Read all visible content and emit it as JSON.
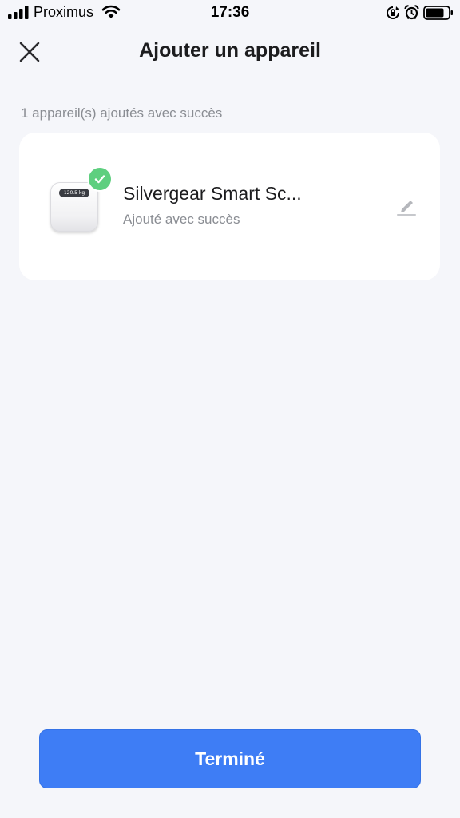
{
  "status_bar": {
    "carrier": "Proximus",
    "time": "17:36",
    "icons": [
      "signal-icon",
      "wifi-icon",
      "lock-rotation-icon",
      "alarm-icon",
      "battery-icon"
    ]
  },
  "header": {
    "title": "Ajouter un appareil",
    "close_icon": "close-icon"
  },
  "summary": "1 appareil(s) ajoutés avec succès",
  "device": {
    "name": "Silvergear Smart Sc...",
    "status": "Ajouté avec succès",
    "display_reading": "120.5 kg",
    "badge_icon": "checkmark-icon",
    "edit_icon": "pencil-icon"
  },
  "footer": {
    "done_label": "Terminé"
  },
  "colors": {
    "background": "#f5f6fa",
    "primary": "#3e7df5",
    "success": "#5ecf7f",
    "secondary_text": "#8a8d93"
  }
}
